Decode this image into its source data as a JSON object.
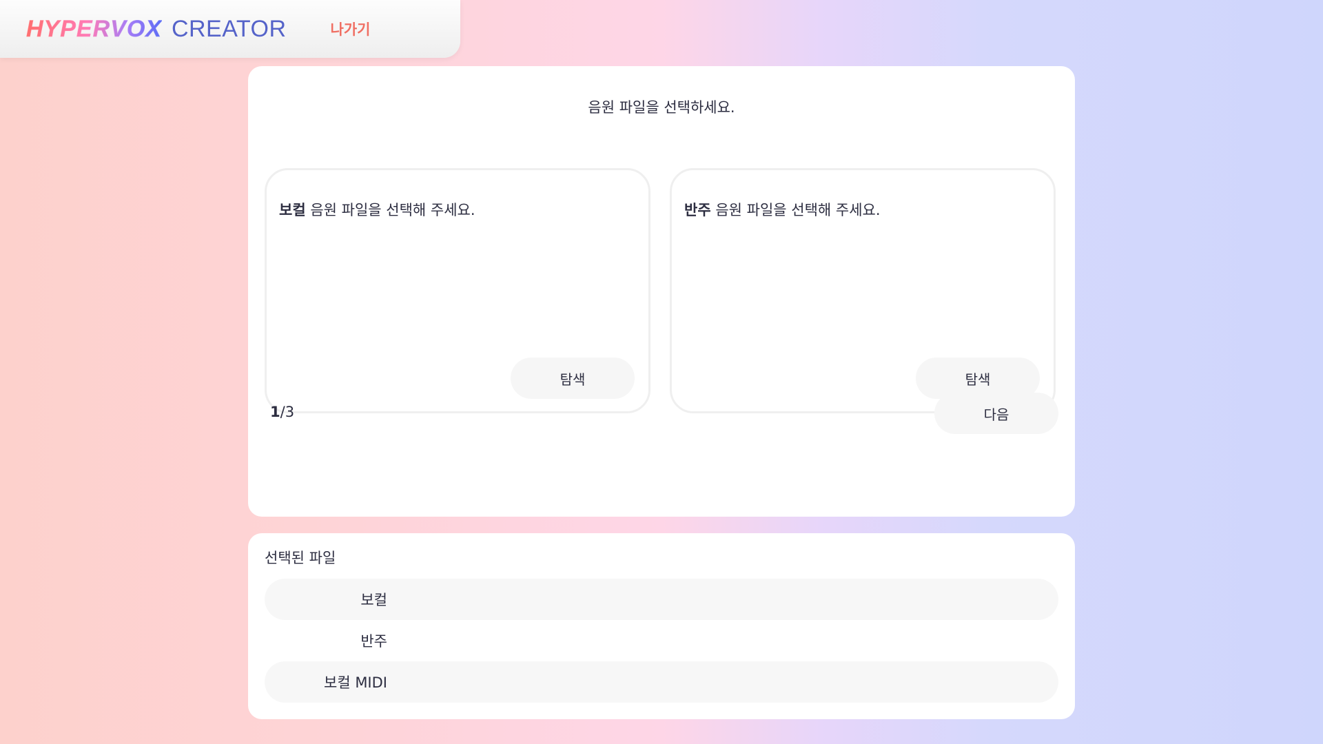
{
  "header": {
    "logo_primary": "HYPERVOX",
    "logo_secondary": "CREATOR",
    "exit_label": "나가기"
  },
  "main": {
    "title": "음원 파일을 선택하세요.",
    "vocal_box": {
      "emphasis": "보컬",
      "text": " 음원 파일을 선택해 주세요.",
      "button_label": "탐색"
    },
    "accompaniment_box": {
      "emphasis": "반주",
      "text": " 음원 파일을 선택해 주세요.",
      "button_label": "탐색"
    },
    "page": {
      "current": "1",
      "total": "/3"
    },
    "next_label": "다음"
  },
  "selected_files": {
    "title": "선택된 파일",
    "rows": [
      {
        "label": "보컬"
      },
      {
        "label": "반주"
      },
      {
        "label": "보컬 MIDI"
      }
    ]
  },
  "colors": {
    "accent_exit": "#f06f63",
    "creator_text": "#5563c9",
    "card_bg": "#ffffff",
    "button_bg": "#f6f6f6"
  }
}
